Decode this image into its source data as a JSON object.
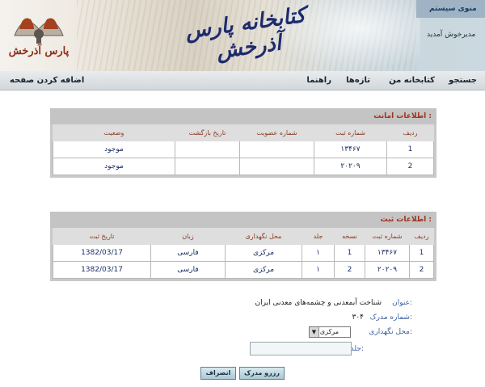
{
  "header": {
    "site_title": "کتابخانه پارس آذرخش",
    "logo_text": "پارس آذرخش",
    "system_menu": "منوی سیستم",
    "welcome": "مدیرخوش آمدید"
  },
  "nav": {
    "items": [
      "جستجو",
      "کتابخانه من",
      "تازه‌ها",
      "راهنما"
    ],
    "add_page": "اضافه کردن صفحه"
  },
  "loan_info": {
    "heading": "اطلاعات امانت :",
    "columns": [
      "ردیف",
      "شماره ثبت",
      "شماره عضویت",
      "تاریخ بازگشت",
      "وضعیت"
    ],
    "rows": [
      [
        "1",
        "۱۳۴۶۷",
        "",
        "",
        "موجود"
      ],
      [
        "2",
        "۲۰۲۰۹",
        "",
        "",
        "موجود"
      ]
    ]
  },
  "register_info": {
    "heading": "اطلاعات ثبت :",
    "columns": [
      "ردیف",
      "شماره ثبت",
      "نسخه",
      "جلد",
      "محل نگهداری",
      "زبان",
      "تاریخ ثبت"
    ],
    "rows": [
      [
        "1",
        "۱۳۴۶۷",
        "1",
        "۱",
        "مرکزی",
        "فارسی",
        "1382/03/17"
      ],
      [
        "2",
        "۲۰۲۰۹",
        "2",
        "۱",
        "مرکزی",
        "فارسی",
        "1382/03/17"
      ]
    ]
  },
  "form": {
    "title_label": "عنوان:",
    "title_value": "شناخت آبمعدنی و چشمه‌های معدنی ایران",
    "doc_no_label": "شماره مدرک:",
    "doc_no_value": "۳۰۴",
    "location_label": "محل نگهداری:",
    "location_value": "مرکزی",
    "volume_label": "جلد:",
    "volume_value": ""
  },
  "buttons": {
    "reserve": "رزرو مدرک",
    "cancel": "انصراف"
  }
}
